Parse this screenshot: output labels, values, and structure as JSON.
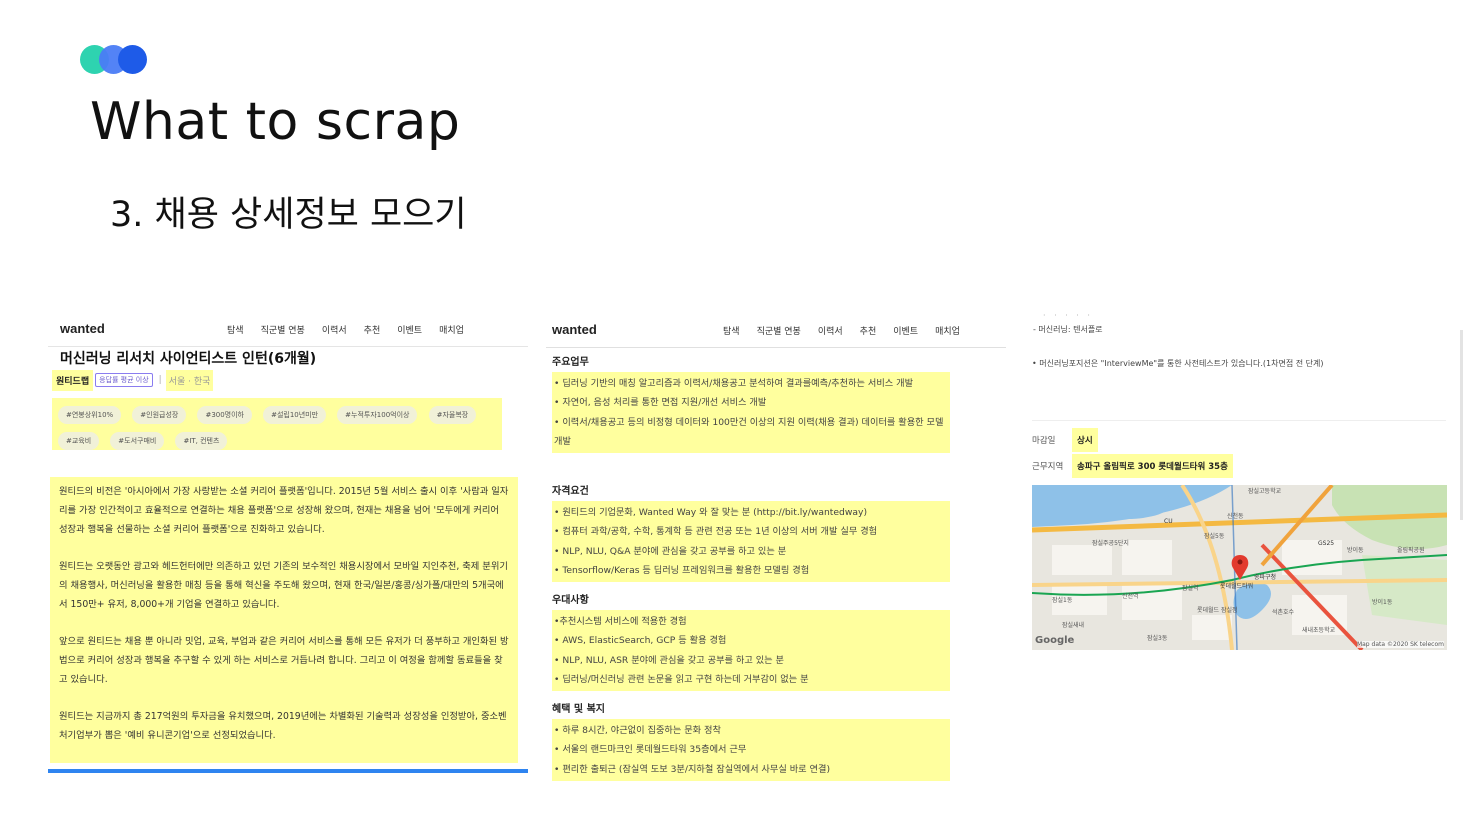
{
  "slide": {
    "title": "What to scrap",
    "subtitle": "3. 채용 상세정보 모으기"
  },
  "colors": {
    "highlight": "#ffff9e",
    "accent": "#2e84f0",
    "dot1": "#2ed3b0",
    "dot2": "#4a7cf5",
    "dot3": "#1e5be8"
  },
  "panel1": {
    "logo": "wanted",
    "nav": [
      "탐색",
      "직군별 연봉",
      "이력서",
      "추천",
      "이벤트",
      "매치업"
    ],
    "job_title": "머신러닝 리서치 사이언티스트 인턴(6개월)",
    "company": "원티드랩",
    "badge": "응답률 평균 이상",
    "separator": "|",
    "location": "서울 · 한국",
    "tags": [
      "#연봉상위10%",
      "#인원급성장",
      "#300명이하",
      "#설립10년미만",
      "#누적투자100억이상",
      "#자율복장",
      "#교육비",
      "#도서구매비",
      "#IT, 컨텐츠"
    ],
    "description": [
      "원티드의 비전은 '아시아에서 가장 사랑받는 소셜 커리어 플랫폼'입니다. 2015년 5월 서비스 출시 이후 '사람과 일자리를 가장 인간적이고 효율적으로 연결하는 채용 플랫폼'으로 성장해 왔으며, 현재는 채용을 넘어 '모두에게 커리어 성장과 행복을 선물하는 소셜 커리어 플랫폼'으로 진화하고 있습니다.",
      "원티드는 오랫동안 광고와 헤드헌터에만 의존하고 있던 기존의 보수적인 채용시장에서 모바일 지인추천, 축제 분위기의 채용행사, 머신러닝을 활용한 매칭 등을 통해 혁신을 주도해 왔으며, 현재 한국/일본/홍콩/싱가폴/대만의 5개국에서 150만+ 유저, 8,000+개 기업을 연결하고 있습니다.",
      "앞으로 원티드는 채용 뿐 아니라 밋업, 교육, 부업과 같은 커리어 서비스를 통해 모든 유저가 더 풍부하고 개인화된 방법으로 커리어 성장과 행복을 추구할 수 있게 하는 서비스로 거듭나려 합니다. 그리고 이 여정을 함께할 동료들을 찾고 있습니다.",
      "원티드는 지금까지 총 217억원의 투자금을 유치했으며, 2019년에는 차별화된 기술력과 성장성을 인정받아, 중소벤처기업부가 뽑은 '예비 유니콘기업'으로 선정되었습니다."
    ]
  },
  "panel2": {
    "logo": "wanted",
    "nav": [
      "탐색",
      "직군별 연봉",
      "이력서",
      "추천",
      "이벤트",
      "매치업"
    ],
    "sections": [
      {
        "title": "주요업무",
        "items": [
          "• 딥러닝 기반의 매칭 알고리즘과 이력서/채용공고 분석하여 결과를예측/추천하는 서비스 개발",
          "• 자연어, 음성 처리를 통한 면접 지원/개선 서비스 개발",
          "• 이력서/채용공고 등의 비정형 데이터와 100만건 이상의 지원 이력(채용 결과) 데이터를 활용한 모델 개발"
        ]
      },
      {
        "title": "자격요건",
        "items": [
          "• 원티드의 기업문화, Wanted Way 와 잘 맞는 분 (http://bit.ly/wantedway)",
          "• 컴퓨터 과학/공학, 수학, 통계학 등 관련 전공 또는 1년 이상의 서버 개발 실무 경험",
          "• NLP, NLU, Q&A 분야에 관심을 갖고 공부를 하고 있는 분",
          "• Tensorflow/Keras 등 딥러닝 프레임워크를 활용한 모델링 경험"
        ]
      },
      {
        "title": "우대사항",
        "items": [
          "•추천시스템 서비스에 적용한 경험",
          "• AWS, ElasticSearch, GCP 등 활용 경험",
          "• NLP, NLU, ASR 분야에 관심을 갖고 공부를 하고 있는 분",
          "• 딥러닝/머신러닝 관련 논문을 읽고 구현 하는데 거부감이 없는 분"
        ]
      },
      {
        "title": "혜택 및 복지",
        "items": [
          "• 하루 8시간, 야근없이 집중하는 문화 정착",
          "• 서울의 랜드마크인 롯데월드타워 35층에서 근무",
          "• 편리한 출퇴근 (잠실역 도보 3분/지하철 잠실역에서 사무실 바로 연결)"
        ]
      }
    ]
  },
  "panel3": {
    "dots": "· · · · ·",
    "line1": "- 머신러닝: 텐서플로",
    "line2": "• 머신러닝포지션은 \"InterviewMe\"를 통한 사전테스트가 있습니다.(1차면접 전 단계)",
    "deadline_label": "마감일",
    "deadline_value": "상시",
    "location_label": "근무지역",
    "location_value": "송파구 올림픽로 300 롯데월드타워 35층",
    "map_labels": {
      "google": "Google",
      "credit": "Map data ©2020 SK telecom",
      "places": [
        "잠실고등학교",
        "신천동",
        "잠실5동",
        "잠실주공5단지",
        "롯데월드타워",
        "송파구청",
        "잠실역",
        "석촌호수",
        "방이동",
        "올림픽공원",
        "잠실1동",
        "신천역",
        "잠실새내",
        "롯데월드 잠실점",
        "잠실3동",
        "방이1동",
        "새내초등학교",
        "CU",
        "GS25"
      ]
    }
  }
}
